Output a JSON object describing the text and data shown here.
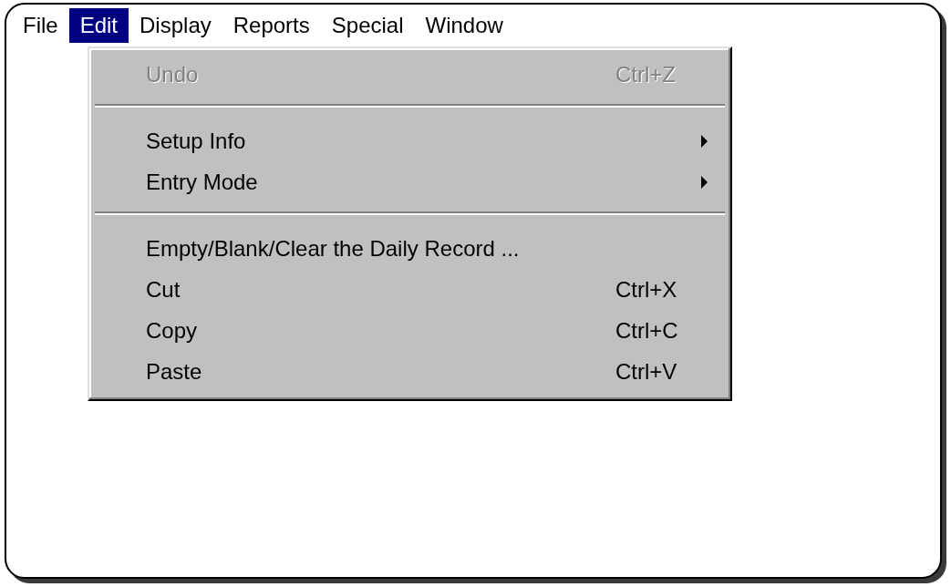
{
  "menu_bar": [
    {
      "label": "File",
      "selected": false
    },
    {
      "label": "Edit",
      "selected": true
    },
    {
      "label": "Display",
      "selected": false
    },
    {
      "label": "Reports",
      "selected": false
    },
    {
      "label": "Special",
      "selected": false
    },
    {
      "label": "Window",
      "selected": false
    }
  ],
  "edit_menu": {
    "items": [
      {
        "kind": "item",
        "label": "Undo",
        "shortcut": "Ctrl+Z",
        "disabled": true,
        "submenu": false
      },
      {
        "kind": "separator"
      },
      {
        "kind": "item",
        "label": "Setup Info",
        "disabled": false,
        "submenu": true
      },
      {
        "kind": "item",
        "label": "Entry Mode",
        "disabled": false,
        "submenu": true
      },
      {
        "kind": "separator"
      },
      {
        "kind": "item",
        "label": "Empty/Blank/Clear the Daily Record ...",
        "disabled": false,
        "submenu": false
      },
      {
        "kind": "item",
        "label": "Cut",
        "shortcut": "Ctrl+X",
        "disabled": false,
        "submenu": false
      },
      {
        "kind": "item",
        "label": "Copy",
        "shortcut": "Ctrl+C",
        "disabled": false,
        "submenu": false
      },
      {
        "kind": "item",
        "label": "Paste",
        "shortcut": "Ctrl+V",
        "disabled": false,
        "submenu": false
      }
    ]
  }
}
